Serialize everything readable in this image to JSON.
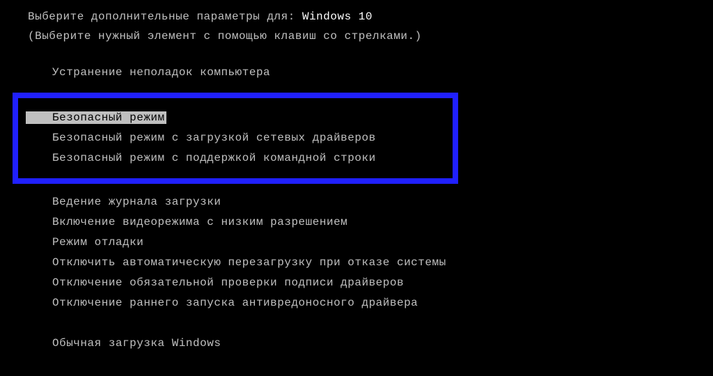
{
  "header": {
    "prefix": "Выберите дополнительные параметры для: ",
    "os": "Windows 10",
    "instruction": "(Выберите нужный элемент с помощью клавиш со стрелками.)"
  },
  "menu": {
    "repair": "Устранение неполадок компьютера",
    "safe_mode": "Безопасный режим",
    "safe_mode_net": "Безопасный режим с загрузкой сетевых драйверов",
    "safe_mode_cmd": "Безопасный режим с поддержкой командной строки",
    "boot_log": "Ведение журнала загрузки",
    "low_res": "Включение видеорежима с низким разрешением",
    "debug": "Режим отладки",
    "no_auto_restart": "Отключить автоматическую перезагрузку при отказе системы",
    "no_sig_enforce": "Отключение обязательной проверки подписи драйверов",
    "no_elam": "Отключение раннего запуска антивредоносного драйвера",
    "normal": "Обычная загрузка Windows"
  }
}
